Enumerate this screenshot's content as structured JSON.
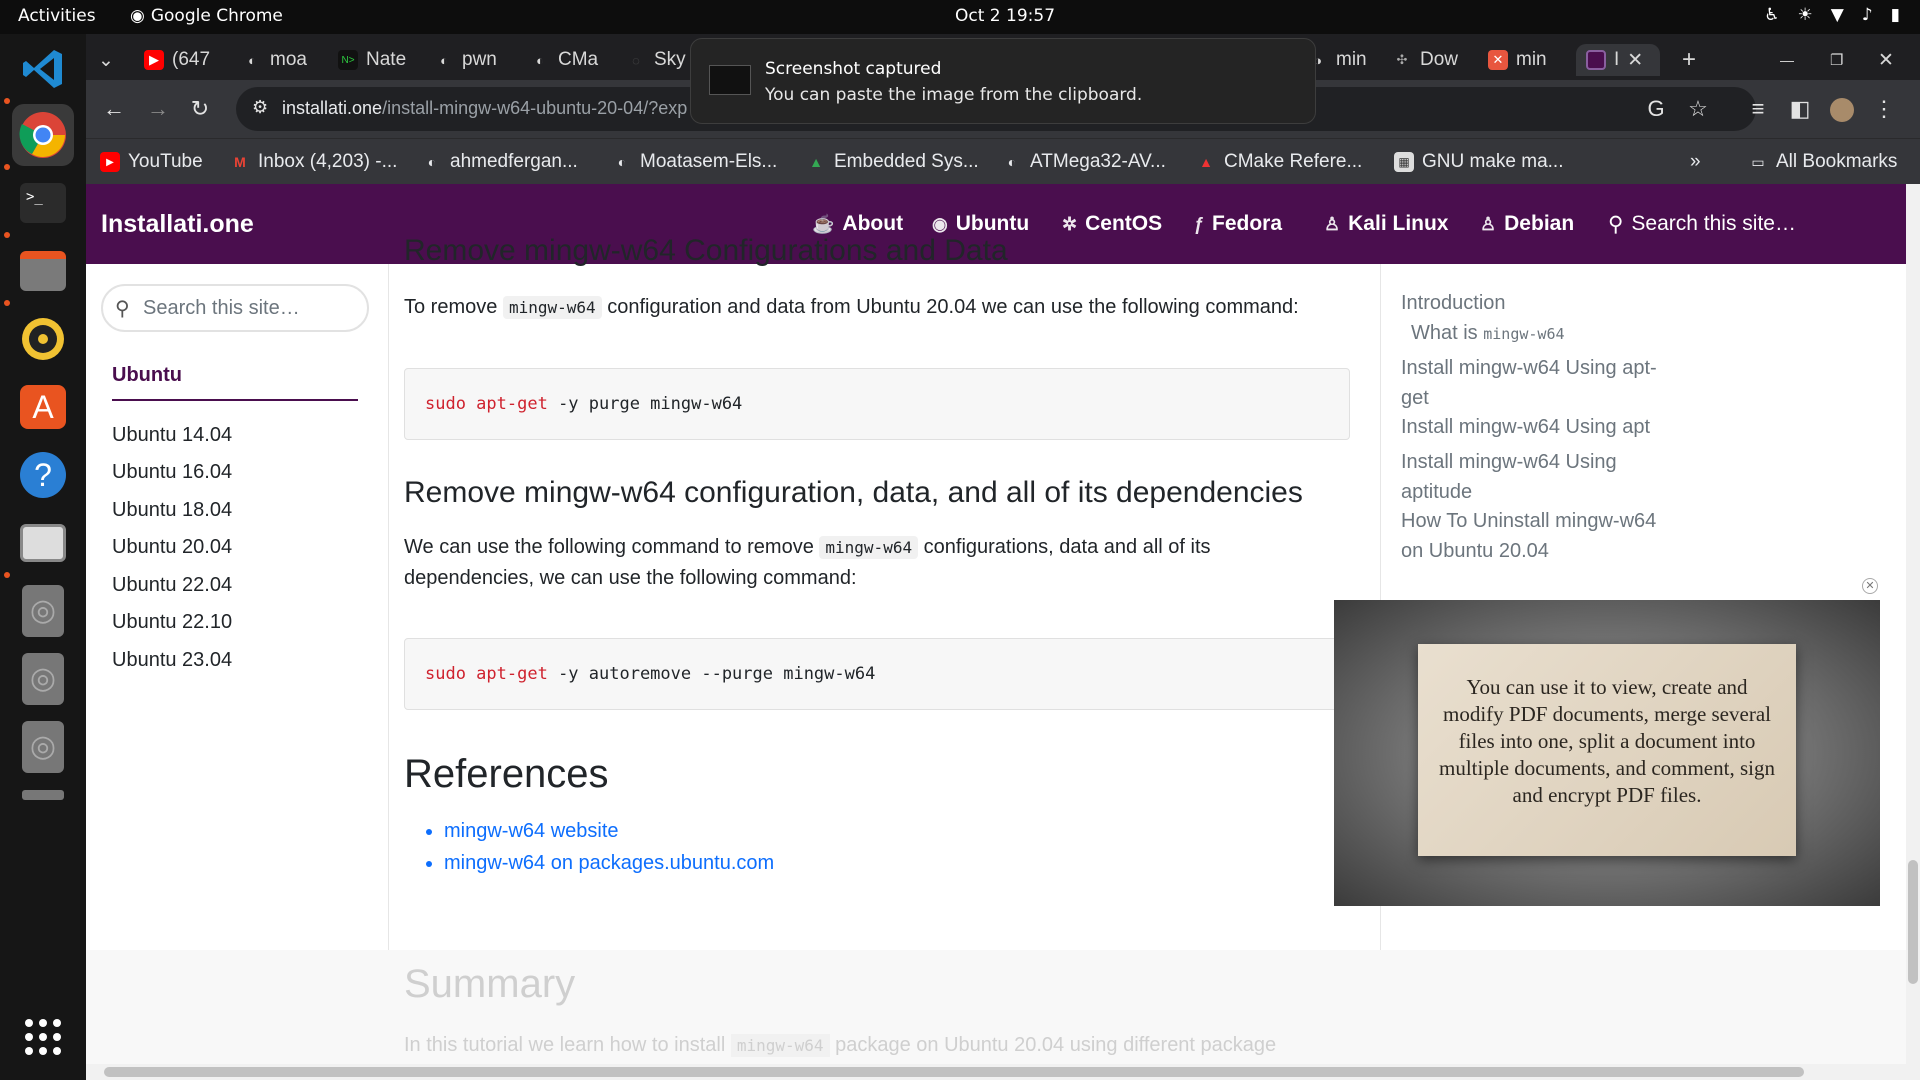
{
  "topbar": {
    "activities": "Activities",
    "app": "Google Chrome",
    "clock": "Oct 2  19:57"
  },
  "tabs": [
    {
      "label": "(647",
      "icon": "youtube-icon"
    },
    {
      "label": "moa",
      "icon": "github-icon"
    },
    {
      "label": "Nate",
      "icon": "terminal-icon"
    },
    {
      "label": "pwn",
      "icon": "github-icon"
    },
    {
      "label": "CMa",
      "icon": "github-icon"
    },
    {
      "label": "Sky",
      "icon": "page-icon"
    },
    {
      "label": "min",
      "icon": "github-icon"
    },
    {
      "label": "Dow",
      "icon": "puzzle-icon"
    },
    {
      "label": "min",
      "icon": "tab-icon"
    },
    {
      "label": "I",
      "icon": "installati-icon"
    }
  ],
  "toolbar": {
    "url_host": "installati.one",
    "url_path": "/install-mingw-w64-ubuntu-20-04/?exp"
  },
  "bookmarks": [
    {
      "label": "YouTube",
      "icon": "youtube-icon"
    },
    {
      "label": "Inbox (4,203) -...",
      "icon": "gmail-icon"
    },
    {
      "label": "ahmedfergan...",
      "icon": "github-icon"
    },
    {
      "label": "Moatasem-Els...",
      "icon": "github-icon"
    },
    {
      "label": "Embedded Sys...",
      "icon": "drive-icon"
    },
    {
      "label": "ATMega32-AV...",
      "icon": "github-icon"
    },
    {
      "label": "CMake Refere...",
      "icon": "cmake-icon"
    },
    {
      "label": "GNU make ma...",
      "icon": "gnu-icon"
    }
  ],
  "bookmarks_more": "»",
  "all_bookmarks": "All Bookmarks",
  "toast": {
    "title": "Screenshot captured",
    "body": "You can paste the image from the clipboard."
  },
  "site": {
    "brand": "Installati.one",
    "nav": [
      "About",
      "Ubuntu",
      "CentOS",
      "Fedora",
      "Kali Linux",
      "Debian"
    ],
    "nav_search": "Search this site…"
  },
  "sidebar": {
    "search_placeholder": "Search this site…",
    "section": "Ubuntu",
    "items": [
      "Ubuntu 14.04",
      "Ubuntu 16.04",
      "Ubuntu 18.04",
      "Ubuntu 20.04",
      "Ubuntu 22.04",
      "Ubuntu 22.10",
      "Ubuntu 23.04"
    ]
  },
  "content": {
    "cut_heading": "Remove mingw-w64 Configurations and Data",
    "p1_a": "To remove ",
    "p1_code": "mingw-w64",
    "p1_b": " configuration and data from Ubuntu 20.04 we can use the following command:",
    "cmd1_a": "sudo apt-get",
    "cmd1_b": " -y purge mingw-w64",
    "h2": "Remove mingw-w64 configuration, data, and all of its dependencies",
    "p2_a": "We can use the following command to remove ",
    "p2_code": "mingw-w64",
    "p2_b": " configurations, data and all of its",
    "p2_c": "dependencies, we can use the following command:",
    "cmd2_a": "sudo apt-get",
    "cmd2_b": " -y autoremove --purge mingw-w64",
    "refs_heading": "References",
    "refs": [
      "mingw-w64 website",
      "mingw-w64 on packages.ubuntu.com"
    ],
    "summary_heading": "Summary",
    "summary_a": "In this tutorial we learn how to install ",
    "summary_code": "mingw-w64",
    "summary_b": " package on Ubuntu 20.04 using different package"
  },
  "toc": {
    "items": [
      "Introduction",
      "What is",
      "Install mingw-w64 Using apt-get",
      "Install mingw-w64 Using apt",
      "Install mingw-w64 Using aptitude",
      "How To Uninstall mingw-w64 on Ubuntu 20.04"
    ],
    "what_is_code": "mingw-w64"
  },
  "video": {
    "text": "You can use it to view, create and modify PDF documents, merge several files into one, split a document into multiple documents, and comment, sign and encrypt PDF files."
  },
  "colors": {
    "site_nav": "#4a0e4e",
    "link": "#0d6efd",
    "code_keyword": "#cf222e"
  }
}
